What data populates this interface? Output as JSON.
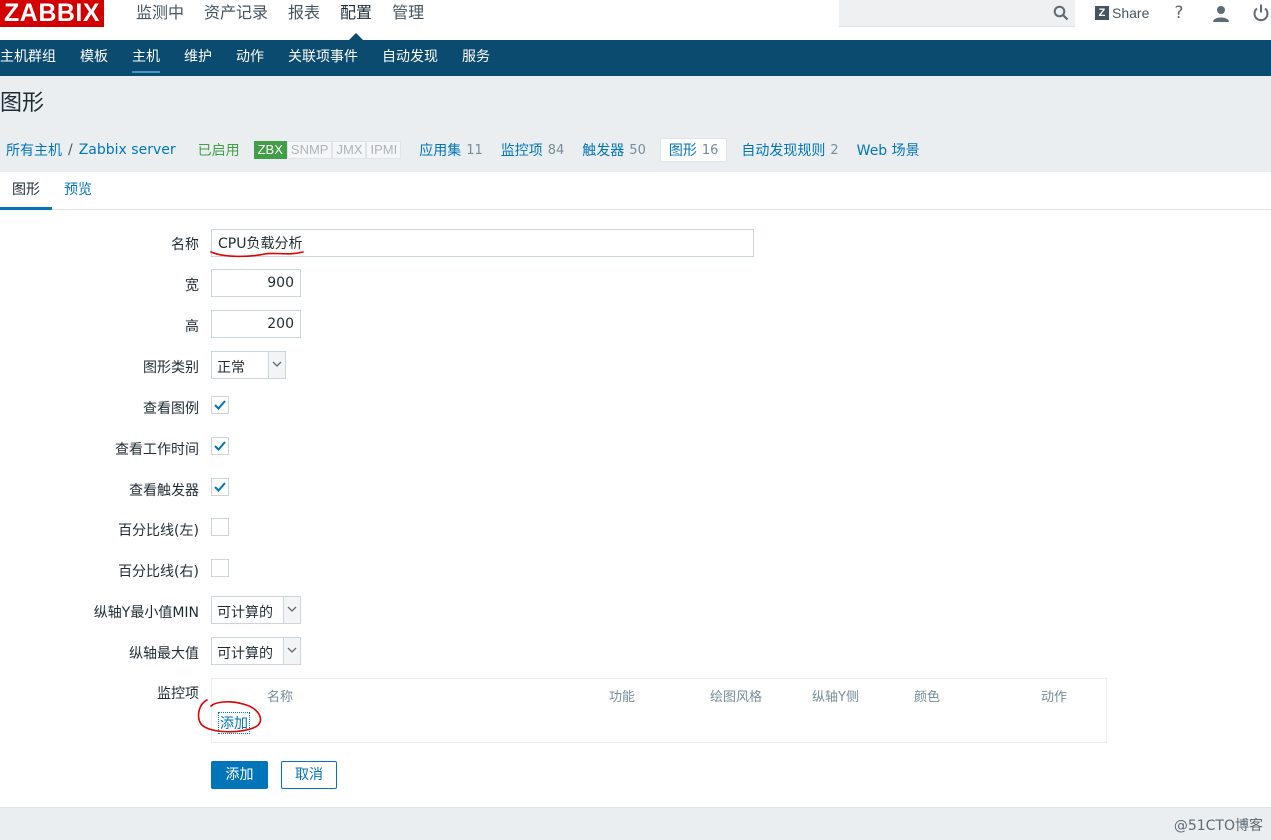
{
  "logo": "ZABBIX",
  "main_menu": [
    {
      "label": "监测中"
    },
    {
      "label": "资产记录"
    },
    {
      "label": "报表"
    },
    {
      "label": "配置"
    },
    {
      "label": "管理"
    }
  ],
  "search": {
    "value": "",
    "placeholder": ""
  },
  "share_label": "Share",
  "top_icons": {
    "help": "?"
  },
  "sub_menu": [
    {
      "label": "主机群组"
    },
    {
      "label": "模板"
    },
    {
      "label": "主机"
    },
    {
      "label": "维护"
    },
    {
      "label": "动作"
    },
    {
      "label": "关联项事件"
    },
    {
      "label": "自动发现"
    },
    {
      "label": "服务"
    }
  ],
  "page_title": "图形",
  "breadcrumb": {
    "all_hosts": "所有主机",
    "separator": "/",
    "host": "Zabbix server",
    "status": "已启用",
    "protocols": [
      "ZBX",
      "SNMP",
      "JMX",
      "IPMI"
    ],
    "items": [
      {
        "label": "应用集",
        "count": "11"
      },
      {
        "label": "监控项",
        "count": "84"
      },
      {
        "label": "触发器",
        "count": "50"
      },
      {
        "label": "图形",
        "count": "16"
      },
      {
        "label": "自动发现规则",
        "count": "2"
      },
      {
        "label": "Web 场景",
        "count": ""
      }
    ]
  },
  "tabs": [
    {
      "label": "图形"
    },
    {
      "label": "预览"
    }
  ],
  "form": {
    "name_label": "名称",
    "name_value": "CPU负载分析",
    "width_label": "宽",
    "width_value": "900",
    "height_label": "高",
    "height_value": "200",
    "graph_type_label": "图形类别",
    "graph_type_value": "正常",
    "show_legend_label": "查看图例",
    "show_working_time_label": "查看工作时间",
    "show_triggers_label": "查看触发器",
    "percentile_left_label": "百分比线(左)",
    "percentile_right_label": "百分比线(右)",
    "ymin_label": "纵轴Y最小值MIN",
    "ymin_value": "可计算的",
    "ymax_label": "纵轴最大值",
    "ymax_value": "可计算的",
    "items_label": "监控项",
    "items_columns": [
      "名称",
      "功能",
      "绘图风格",
      "纵轴Y侧",
      "颜色",
      "动作"
    ],
    "items_add_link": "添加",
    "submit_label": "添加",
    "cancel_label": "取消"
  },
  "watermark": "@51CTO博客",
  "colors": {
    "brand_red": "#d40000",
    "nav_blue": "#0b4b6f",
    "link_blue": "#0275b8",
    "enabled_green": "#429e47",
    "annotation_red": "#e00000"
  }
}
